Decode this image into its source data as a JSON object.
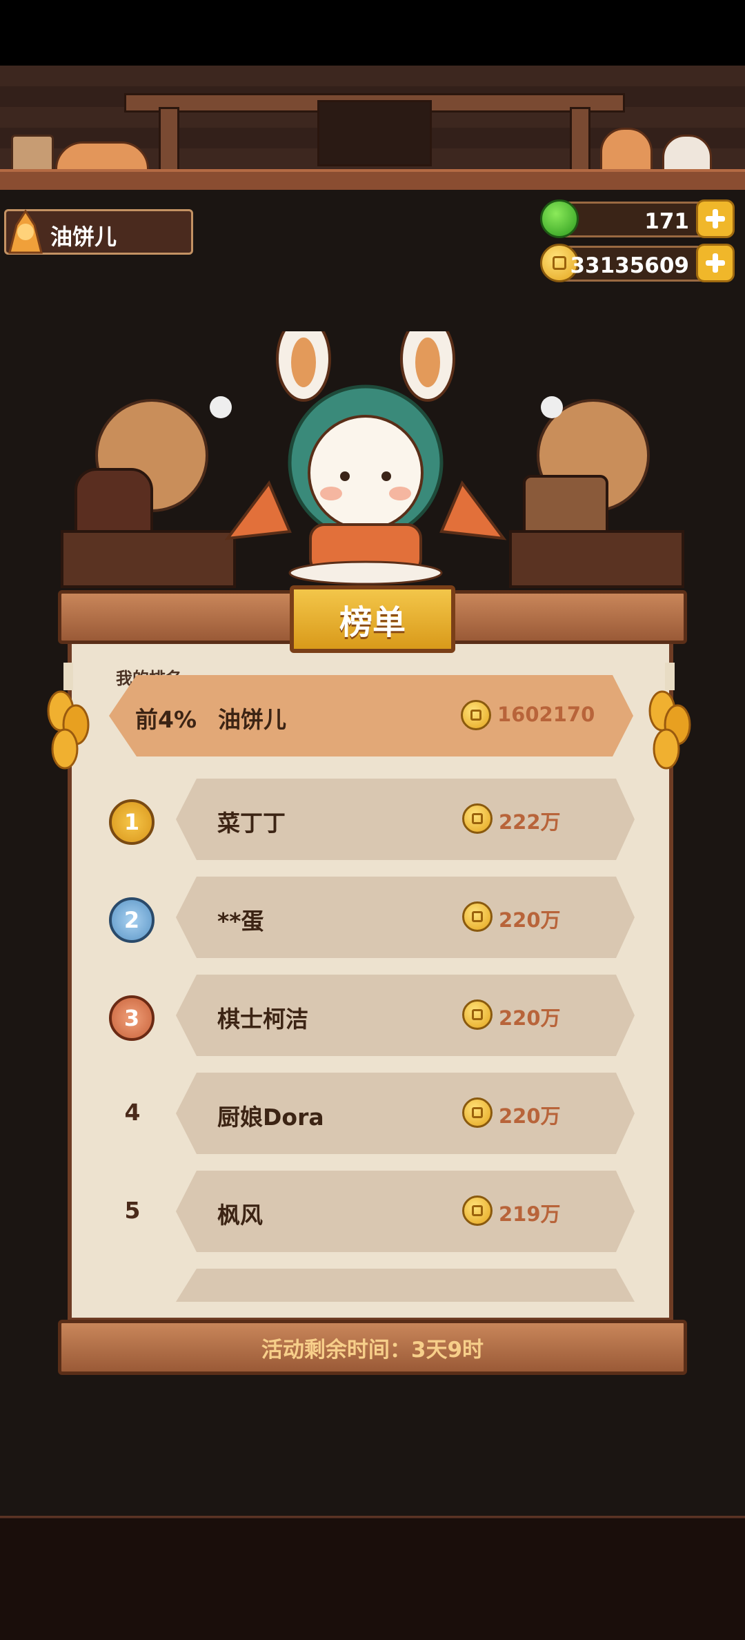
{
  "player": {
    "name": "油饼儿"
  },
  "currency": {
    "gems": "171",
    "coins": "33135609"
  },
  "leaderboard": {
    "title": "榜单",
    "my_rank_label": "我的排名",
    "my_rank": {
      "rank": "前4%",
      "name": "油饼儿",
      "score": "1602170"
    },
    "entries": [
      {
        "rank": "1",
        "name": "菜丁丁",
        "score": "222万"
      },
      {
        "rank": "2",
        "name": "**蛋",
        "score": "220万"
      },
      {
        "rank": "3",
        "name": "棋士柯洁",
        "score": "220万"
      },
      {
        "rank": "4",
        "name": "厨娘Dora",
        "score": "220万"
      },
      {
        "rank": "5",
        "name": "枫风",
        "score": "219万"
      }
    ],
    "footer": "活动剩余时间：3天9时"
  },
  "colors": {
    "gold": "#f0b72a",
    "board": "#ede2cf",
    "my_row": "#e2a877",
    "row": "#d9c7b1"
  }
}
